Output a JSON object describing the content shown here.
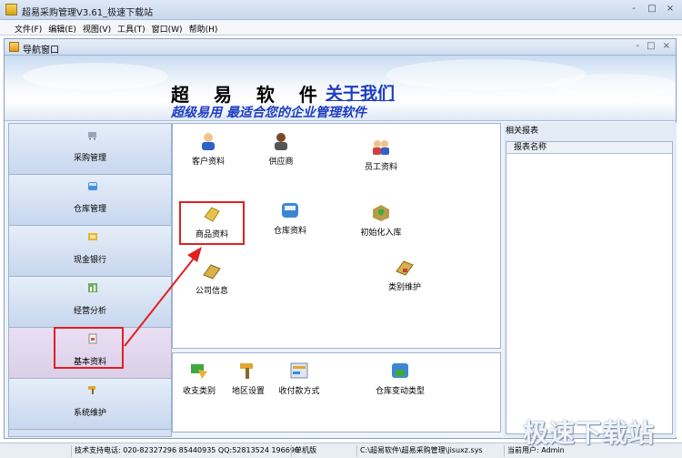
{
  "window": {
    "title": "超易采购管理V3.61_极速下载站",
    "buttons": [
      "-",
      "□",
      "×"
    ]
  },
  "menu": [
    "文件(F)",
    "编辑(E)",
    "视图(V)",
    "工具(T)",
    "窗口(W)",
    "帮助(H)"
  ],
  "subwindow": {
    "title": "导航窗口",
    "buttons": [
      "-",
      "□",
      "×"
    ]
  },
  "banner": {
    "brand": "超 易 软 件",
    "about": "关于我们",
    "slogan": "超级易用 最适合您的企业管理软件"
  },
  "sidebar": {
    "items": [
      {
        "label": "采购管理",
        "icon": "cart-icon"
      },
      {
        "label": "仓库管理",
        "icon": "warehouse-icon"
      },
      {
        "label": "现金银行",
        "icon": "bank-icon"
      },
      {
        "label": "经营分析",
        "icon": "chart-icon"
      },
      {
        "label": "基本资料",
        "icon": "document-icon"
      },
      {
        "label": "系统维护",
        "icon": "hammer-icon"
      }
    ]
  },
  "main_items": {
    "customer": "客户资料",
    "supplier": "供应商",
    "employee": "员工资料",
    "product": "商品资料",
    "warehouse": "仓库资料",
    "initial_stock": "初始化入库",
    "company": "公司信息",
    "category": "类别维护"
  },
  "bottom_items": {
    "income_type": "收支类别",
    "region": "地区设置",
    "payment": "收付款方式",
    "stock_change": "仓库变动类型"
  },
  "reports": {
    "title": "相关报表",
    "column": "报表名称"
  },
  "statusbar": {
    "support": "技术支持电话: 020-82327296 85440935 QQ:52813524 196690",
    "mode": "单机版",
    "path": "C:\\超易软件\\超易采购管理\\jisuxz.sys",
    "user": "当前用户: Admin"
  },
  "watermark": "极速下载站",
  "colors": {
    "accent": "#1d3cc2",
    "highlight": "#e02020"
  }
}
